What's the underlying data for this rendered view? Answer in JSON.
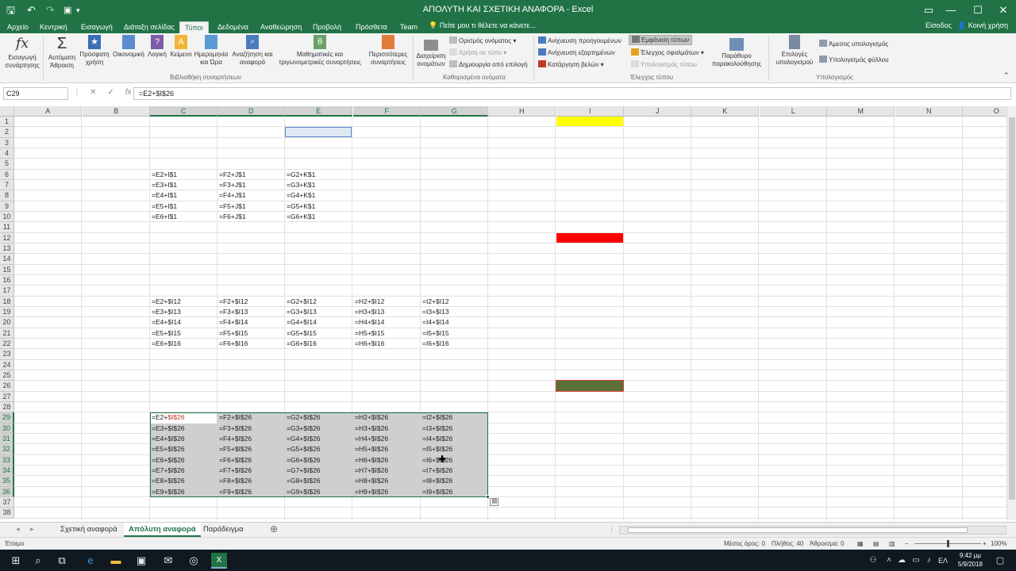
{
  "window": {
    "title": "ΑΠΟΛΥΤΗ ΚΑΙ ΣΧΕΤΙΚΗ ΑΝΑΦΟΡΑ - Excel",
    "tell_me": "Πείτε μου τι θέλετε να κάνετε...",
    "sign_in": "Είσοδος",
    "share": "Κοινή χρήση"
  },
  "tabs": [
    "Αρχείο",
    "Κεντρική",
    "Εισαγωγή",
    "Διάταξη σελίδας",
    "Τύποι",
    "Δεδομένα",
    "Αναθεώρηση",
    "Προβολή",
    "Πρόσθετα",
    "Team"
  ],
  "ribbon": {
    "insert_function": "Εισαγωγή συνάρτησης",
    "autosum": "Αυτόματη Άθροιση",
    "recent": "Πρόσφατη χρήση",
    "financial": "Οικονομική",
    "logical": "Λογική",
    "text": "Κείμενο",
    "datetime": "Ημερομηνία και Ώρα",
    "lookup": "Αναζήτηση και αναφορά",
    "math": "Μαθηματικές και τριγωνομετρικές συναρτήσεις",
    "more": "Περισσότερες συναρτήσεις",
    "group_library": "Βιβλιοθήκη συναρτήσεων",
    "name_manager": "Διαχείριση ονομάτων",
    "define_name": "Ορισμός ονόματος",
    "use_in_formula": "Χρήση σε τύπο",
    "create_from_selection": "Δημιουργία από επιλογή",
    "group_names": "Καθορισμένα ονόματα",
    "trace_precedents": "Ανίχνευση προηγουμένων",
    "trace_dependents": "Ανίχνευση εξαρτημένων",
    "remove_arrows": "Κατάργηση βελών",
    "show_formulas": "Εμφάνιση τύπων",
    "error_checking": "Έλεγχος σφαλμάτων",
    "evaluate_formula": "Υπολογισμός τύπου",
    "watch_window": "Παράθυρο παρακολούθησης",
    "group_auditing": "Έλεγχος τύπου",
    "calc_options": "Επιλογές υπολογισμού",
    "calc_now": "Άμεσος υπολογισμός",
    "calc_sheet": "Υπολογισμός φύλλου",
    "group_calc": "Υπολογισμός"
  },
  "formula_bar": {
    "name_box": "C29",
    "formula": "=E2+$I$26"
  },
  "columns": [
    "A",
    "B",
    "C",
    "D",
    "E",
    "F",
    "G",
    "H",
    "I",
    "J",
    "K",
    "L",
    "M",
    "N",
    "O"
  ],
  "rows": [
    "1",
    "2",
    "3",
    "4",
    "5",
    "6",
    "7",
    "8",
    "9",
    "10",
    "11",
    "12",
    "13",
    "14",
    "15",
    "16",
    "17",
    "18",
    "19",
    "20",
    "21",
    "22",
    "23",
    "24",
    "25",
    "26",
    "27",
    "28",
    "29",
    "30",
    "31",
    "32",
    "33",
    "34",
    "35",
    "36",
    "37",
    "38"
  ],
  "block1": [
    [
      "=E2+I$1",
      "=F2+J$1",
      "=G2+K$1"
    ],
    [
      "=E3+I$1",
      "=F3+J$1",
      "=G3+K$1"
    ],
    [
      "=E4+I$1",
      "=F4+J$1",
      "=G4+K$1"
    ],
    [
      "=E5+I$1",
      "=F5+J$1",
      "=G5+K$1"
    ],
    [
      "=E6+I$1",
      "=F6+J$1",
      "=G6+K$1"
    ]
  ],
  "block2": [
    [
      "=E2+$I12",
      "=F2+$I12",
      "=G2+$I12",
      "=H2+$I12",
      "=I2+$I12"
    ],
    [
      "=E3+$I13",
      "=F3+$I13",
      "=G3+$I13",
      "=H3+$I13",
      "=I3+$I13"
    ],
    [
      "=E4+$I14",
      "=F4+$I14",
      "=G4+$I14",
      "=H4+$I14",
      "=I4+$I14"
    ],
    [
      "=E5+$I15",
      "=F5+$I15",
      "=G5+$I15",
      "=H5+$I15",
      "=I5+$I15"
    ],
    [
      "=E6+$I16",
      "=F6+$I16",
      "=G6+$I16",
      "=H6+$I16",
      "=I6+$I16"
    ]
  ],
  "block3_first": "=E2+",
  "block3_first_ref": "$I$26",
  "block3": [
    [
      "",
      "=F2+$I$26",
      "=G2+$I$26",
      "=H2+$I$26",
      "=I2+$I$26"
    ],
    [
      "=E3+$I$26",
      "=F3+$I$26",
      "=G3+$I$26",
      "=H3+$I$26",
      "=I3+$I$26"
    ],
    [
      "=E4+$I$26",
      "=F4+$I$26",
      "=G4+$I$26",
      "=H4+$I$26",
      "=I4+$I$26"
    ],
    [
      "=E5+$I$26",
      "=F5+$I$26",
      "=G5+$I$26",
      "=H5+$I$26",
      "=I5+$I$26"
    ],
    [
      "=E6+$I$26",
      "=F6+$I$26",
      "=G6+$I$26",
      "=H6+$I$26",
      "=I6+$I$26"
    ],
    [
      "=E7+$I$26",
      "=F7+$I$26",
      "=G7+$I$26",
      "=H7+$I$26",
      "=I7+$I$26"
    ],
    [
      "=E8+$I$26",
      "=F8+$I$26",
      "=G8+$I$26",
      "=H8+$I$26",
      "=I8+$I$26"
    ],
    [
      "=E9+$I$26",
      "=F9+$I$26",
      "=G9+$I$26",
      "=H9+$I$26",
      "=I9+$I$26"
    ]
  ],
  "fills": {
    "I1": "#ffff00",
    "I12": "#ff0000",
    "I26": "#5a7035",
    "E2": "#dde8f3"
  },
  "sheets": [
    "Σχετική αναφορά",
    "Απόλυτη αναφορά",
    "Παράδειγμα"
  ],
  "status": {
    "ready": "Έτοιμο",
    "average": "Μέσος όρος: 0",
    "count": "Πλήθος: 40",
    "sum": "Άθροισμα: 0",
    "zoom": "100%"
  },
  "taskbar": {
    "time": "9:42 μμ",
    "date": "5/9/2018",
    "lang": "ΕΛ"
  },
  "accent": "#217346"
}
